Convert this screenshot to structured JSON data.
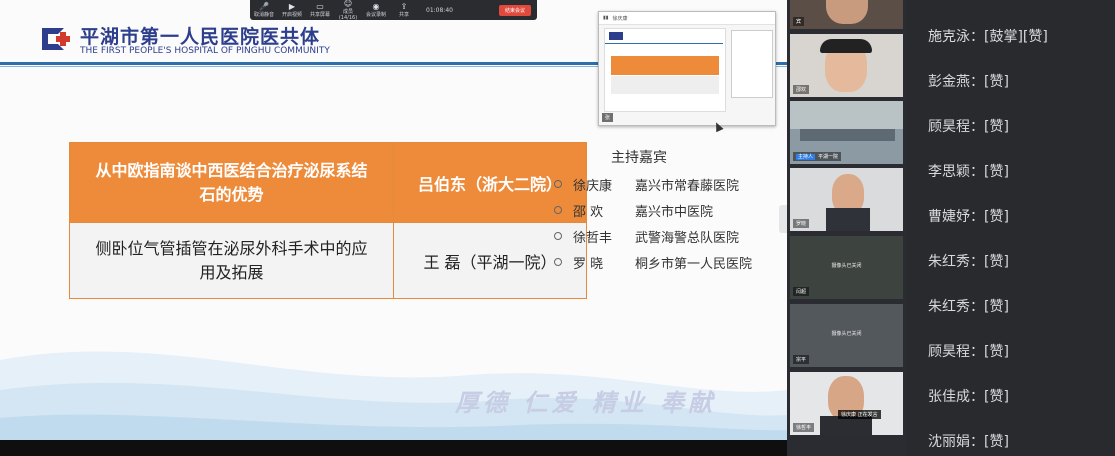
{
  "toolbar": {
    "items": [
      "取消静音",
      "开启视频",
      "共享屏幕",
      "成员(14/16)",
      "会议录制",
      "共享"
    ],
    "time": "01:08:40",
    "end_label": "结束会议"
  },
  "header": {
    "hospital_cn": "平湖市第一人民医院医共体",
    "hospital_en": "THE FIRST PEOPLE'S HOSPITAL OF PINGHU COMMUNITY"
  },
  "schedule": [
    {
      "topic": "从中欧指南谈中西医结合治疗泌尿系结石的优势",
      "speaker": "吕伯东（浙大二院）"
    },
    {
      "topic": "侧卧位气管插管在泌尿外科手术中的应用及拓展",
      "speaker": "王 磊（平湖一院）"
    }
  ],
  "hosts": {
    "title": "主持嘉宾",
    "items": [
      {
        "name": "徐庆康",
        "org": "嘉兴市常春藤医院"
      },
      {
        "name": "邵 欢",
        "org": "嘉兴市中医院"
      },
      {
        "name": "徐哲丰",
        "org": "武警海警总队医院"
      },
      {
        "name": "罗 晓",
        "org": "桐乡市第一人民医院"
      }
    ]
  },
  "motto": "厚德 仁爱 精业 奉献",
  "pip": {
    "title": "徐庆康",
    "label": "张"
  },
  "videos": [
    {
      "label": "宾",
      "off_text": ""
    },
    {
      "label": "邵欢",
      "off_text": ""
    },
    {
      "label": "平湖一院",
      "host_tag": "主持人",
      "off_text": ""
    },
    {
      "label": "罗晓",
      "off_text": ""
    },
    {
      "label": "闫超",
      "off_text": "摄像头已关闭"
    },
    {
      "label": "宗平",
      "off_text": "摄像头已关闭"
    },
    {
      "label": "徐哲丰",
      "off_text": "",
      "speaking": "徐庆康  正在发言"
    }
  ],
  "chat": [
    {
      "name": "施克泳",
      "msg": "[鼓掌][赞]"
    },
    {
      "name": "彭金燕",
      "msg": "[赞]"
    },
    {
      "name": "顾昊程",
      "msg": "[赞]"
    },
    {
      "name": "李思颖",
      "msg": "[赞]"
    },
    {
      "name": "曹婕妤",
      "msg": "[赞]"
    },
    {
      "name": "朱红秀",
      "msg": "[赞]"
    },
    {
      "name": "朱红秀",
      "msg": "[赞]"
    },
    {
      "name": "顾昊程",
      "msg": "[赞]"
    },
    {
      "name": "张佳成",
      "msg": "[赞]"
    },
    {
      "name": "沈丽娟",
      "msg": "[赞]"
    }
  ],
  "colors": {
    "accent_orange": "#ee8b3b",
    "brand_blue": "#2d3e8c",
    "end_red": "#e04a3c"
  }
}
